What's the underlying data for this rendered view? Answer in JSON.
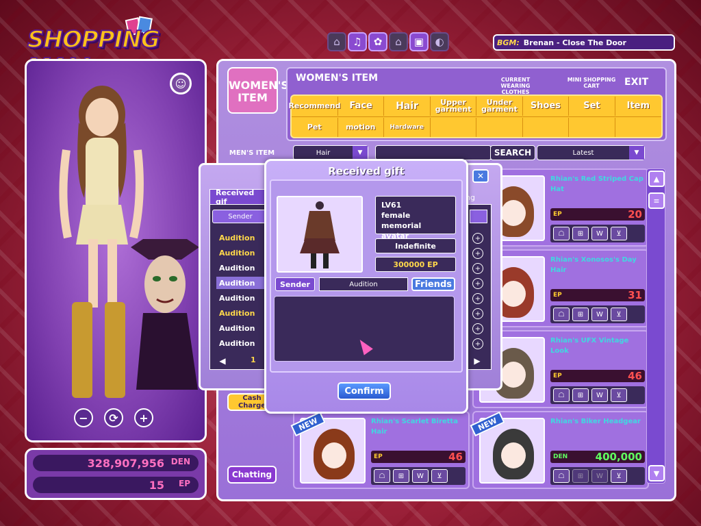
{
  "logo": {
    "text": "SHOPPING MALL"
  },
  "top_icons": [
    {
      "name": "inactive-icon",
      "glyph": "⌂",
      "active": false
    },
    {
      "name": "tune-icon",
      "glyph": "♫",
      "active": true
    },
    {
      "name": "gear-icon",
      "glyph": "✿",
      "active": true
    },
    {
      "name": "inactive-icon",
      "glyph": "⌂",
      "active": false
    },
    {
      "name": "tv-icon",
      "glyph": "▣",
      "active": true
    },
    {
      "name": "inactive-icon",
      "glyph": "◐",
      "active": false
    }
  ],
  "bgm": {
    "label": "BGM:",
    "track": "Brenan - Close The Door"
  },
  "avatar": {
    "zoom_out": "−",
    "rotate": "⟳",
    "zoom_in": "+"
  },
  "wallet": {
    "den_value": "328,907,956",
    "den_unit": "DEN",
    "ep_value": "15",
    "ep_unit": "EP",
    "den_color": "#ff70c0",
    "ep_color": "#ff70c0"
  },
  "shop": {
    "category_logo": "WOMEN'S ITEM",
    "title": "WOMEN'S ITEM",
    "current_wearing": "CURRENT WEARING CLOTHES",
    "mini_cart": "MINI SHOPPING CART",
    "exit": "EXIT",
    "tabs_row1": [
      "Recommend",
      "Face",
      "Hair",
      "Upper garment",
      "Under garment",
      "Shoes",
      "Set",
      "Item"
    ],
    "tabs_row2": [
      "Pet",
      "motion",
      "Hardware",
      "",
      "",
      "",
      "",
      ""
    ],
    "active_tab": "Hair",
    "filter_category": "Hair",
    "search_value": "",
    "search_label": "SEARCH",
    "sort_value": "Latest",
    "side_mens": "MEN'S ITEM",
    "side_cash": "Cash Charge",
    "chat_label": "Chatting"
  },
  "items": [
    {
      "name": "Rhian's Red Striped Cap Hat",
      "unit": "EP",
      "price": "20",
      "den": false,
      "hair_color": "#8a4a2a",
      "new": false
    },
    {
      "name": "Rhian's Xonosos's Day Hair",
      "unit": "EP",
      "price": "31",
      "den": false,
      "hair_color": "#9a3a2a",
      "new": false
    },
    {
      "name": "Rhian's UFX Vintage Look",
      "unit": "EP",
      "price": "46",
      "den": false,
      "hair_color": "#6a5a4a",
      "new": false
    },
    {
      "name": "Rhian's Scarlet Biretta Hair",
      "unit": "EP",
      "price": "46",
      "den": false,
      "hair_color": "#8a3a1a",
      "new": true
    },
    {
      "name": "Rhian's Biker Headgear",
      "unit": "DEN",
      "price": "400,000",
      "den": true,
      "hair_color": "#3a3a3a",
      "new": true
    }
  ],
  "card_actions": [
    "☖",
    "⊞",
    "W",
    "⊻"
  ],
  "new_badge": "NEW",
  "back_dialog": {
    "tab_label": "Received gif",
    "right_label": "ng",
    "sender_header": "Sender",
    "rows": [
      "Audition",
      "Audition",
      "Audition",
      "Audition",
      "Audition",
      "Audition",
      "Audition",
      "Audition"
    ],
    "page": "1",
    "close": "✕"
  },
  "gift_dialog": {
    "title": "Received gift",
    "info_level": "LV61",
    "info_gender": "female",
    "info_type": "memorial avatar",
    "period": "Indefinite",
    "price": "300000 EP",
    "sender_label": "Sender",
    "sender_value": "Audition",
    "friends_label": "Friends",
    "confirm_label": "Confirm"
  }
}
